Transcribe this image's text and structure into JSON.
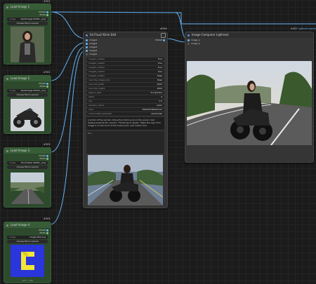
{
  "colors": {
    "canvas": "#1b1b1b",
    "node_green": "#2d4a2d",
    "node_gray": "#353535",
    "wire_blue": "#64b5f6",
    "wire_green": "#81c784"
  },
  "load1": {
    "id": "#301",
    "title": "Load Image 1",
    "out_image": "IMAGE",
    "out_mask": "MASK",
    "file_key": "image",
    "file_value": "Seedimage 00001_.png",
    "upload": "choose file to upload"
  },
  "load2": {
    "id": "#302",
    "title": "Load Image 2",
    "out_image": "IMAGE",
    "out_mask": "MASK",
    "file_key": "image",
    "file_value": "Seedimage 00004_.png",
    "upload": "choose file to upload"
  },
  "load3": {
    "id": "#305",
    "title": "Load Image 3",
    "out_image": "IMAGE",
    "out_mask": "MASK",
    "file_key": "image",
    "file_value": "Flux2-Klein 00001_.png",
    "upload": "choose file to upload"
  },
  "load4": {
    "id": "#304",
    "title": "Load Image 4",
    "out_image": "IMAGE",
    "out_mask": "MASK",
    "file_key": "image",
    "file_value": "image 041.png",
    "upload": "choose file to upload",
    "caption": "180 × 180"
  },
  "flux": {
    "id": "#306",
    "title": "fal Flux2 Klein Edit",
    "inputs": [
      "image1",
      "image2",
      "image3",
      "image4",
      "image5"
    ],
    "output": "IMAGE",
    "widgets": [
      {
        "k": "image1_enable",
        "v": "true"
      },
      {
        "k": "image2_enable",
        "v": "true"
      },
      {
        "k": "image3_enable",
        "v": "true"
      },
      {
        "k": "image4_enable",
        "v": "true"
      },
      {
        "k": "image5_enable",
        "v": "false"
      },
      {
        "k": "override_image_size",
        "v": "false"
      },
      {
        "k": "override_width",
        "v": "1024"
      },
      {
        "k": "override_height",
        "v": "1024"
      },
      {
        "k": "aspect_ratio",
        "v": "3:2 (photo)"
      },
      {
        "k": "steps",
        "v": "4"
      },
      {
        "k": "cfg",
        "v": "1.0"
      },
      {
        "k": "sampler_name",
        "v": "euler"
      },
      {
        "k": "seed",
        "v": "700443784391113"
      },
      {
        "k": "control after generate",
        "v": "randomize"
      }
    ],
    "prompt": "A photo of the woman riding the motorcycle on the scenic road. Seeing towards the camera. 'Flickering of speed'. Make the logo from image 4 on the front of the motorcycle, add motion blur.",
    "preview_label": "Run"
  },
  "compare": {
    "id": "#307",
    "title": "Image Comparer (rgthree)",
    "badge": "rgthree.comfy",
    "in_a": "image_a",
    "in_b": "image_b"
  }
}
